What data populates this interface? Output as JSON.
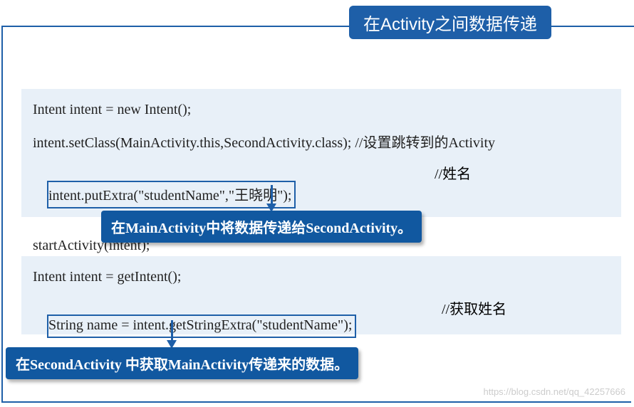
{
  "title": "在Activity之间数据传递",
  "block1": {
    "line1": "Intent intent = new Intent();",
    "line2": "intent.setClass(MainActivity.this,SecondActivity.class); //设置跳转到的Activity",
    "line3_boxed": "intent.putExtra(\"studentName\",\"王晓明\");",
    "line3_comment": "//姓名",
    "line4": "startActivity(intent);"
  },
  "callout1": "在MainActivity中将数据传递给SecondActivity。",
  "block2": {
    "line1": "Intent intent = getIntent();",
    "line2_boxed": "String name = intent.getStringExtra(\"studentName\");",
    "line2_comment": "//获取姓名"
  },
  "callout2": "在SecondActivity 中获取MainActivity传递来的数据。",
  "watermark": "https://blog.csdn.net/qq_42257666"
}
